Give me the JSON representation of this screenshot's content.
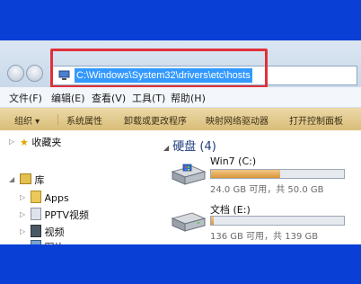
{
  "address": {
    "path": "C:\\Windows\\System32\\drivers\\etc\\hosts"
  },
  "menubar": [
    "文件(F)",
    "编辑(E)",
    "查看(V)",
    "工具(T)",
    "帮助(H)"
  ],
  "toolbar": {
    "organize": "组织 ▾",
    "items": [
      "系统属性",
      "卸载或更改程序",
      "映射网络驱动器",
      "打开控制面板"
    ]
  },
  "nav": {
    "favorites": "收藏夹",
    "libraries": "库",
    "items": [
      "Apps",
      "PPTV视频",
      "视频"
    ],
    "cut_item": "图片"
  },
  "content": {
    "group_label": "硬盘 (4)",
    "drives": [
      {
        "name": "Win7 (C:)",
        "free_text": "24.0 GB 可用，共 50.0 GB",
        "used_fraction": 0.52
      },
      {
        "name": "文档 (E:)",
        "free_text": "136 GB 可用，共 139 GB",
        "used_fraction": 0.02
      }
    ]
  },
  "colors": {
    "background": "#0a3fd6",
    "highlight": "#e0313a",
    "selection": "#3399ff"
  }
}
